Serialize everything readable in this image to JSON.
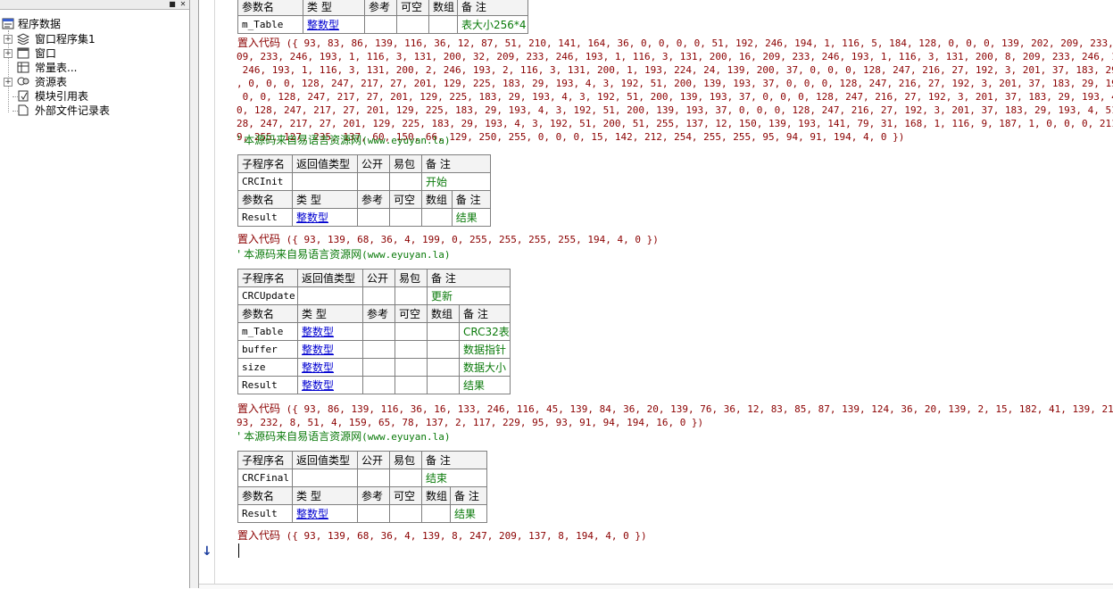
{
  "tree": {
    "root": "程序数据",
    "items": [
      {
        "label": "窗口程序集1"
      },
      {
        "label": "窗口"
      },
      {
        "label": "常量表..."
      },
      {
        "label": "资源表"
      },
      {
        "label": "模块引用表"
      },
      {
        "label": "外部文件记录表"
      }
    ],
    "topbar": {
      "pin": "■",
      "close": "✕"
    }
  },
  "headers": {
    "sub": "子程序名",
    "ret": "返回值类型",
    "pub": "公开",
    "easy": "易包",
    "note": "备 注",
    "param": "参数名",
    "type": "类 型",
    "ref": "参考",
    "nullable": "可空",
    "array": "数组"
  },
  "top_table": {
    "param": "m_Table",
    "type": "整数型",
    "note": "表大小256*4"
  },
  "block1": {
    "kw": "置入代码",
    "lines": [
      " ({ 93, 83, 86, 139, 116, 36, 12, 87, 51, 210, 141, 164, 36, 0, 0, 0, 0, 51, 192, 246, 194, 1, 116, 5, 184, 128, 0, 0, 0, 139, 202, 209, 233, 246, 193, 1, 116,",
      "09, 233, 246, 193, 1, 116, 3, 131, 200, 32, 209, 233, 246, 193, 1, 116, 3, 131, 200, 16, 209, 233, 246, 193, 1, 116, 3, 131, 200, 8, 209, 233, 246, 193, 1, 116, 3,",
      " 246, 193, 1, 116, 3, 131, 200, 2, 246, 193, 2, 116, 3, 131, 200, 1, 193, 224, 24, 139, 200, 37, 0, 0, 0, 128, 247, 216, 27, 192, 3, 201, 37, 183, 29, 193, 4, 51,",
      ", 0, 0, 0, 128, 247, 217, 27, 201, 129, 225, 183, 29, 193, 4, 3, 192, 51, 200, 139, 193, 37, 0, 0, 0, 128, 247, 216, 27, 192, 3, 201, 37, 183, 29, 193, 4, 51, 193,",
      " 0, 0, 128, 247, 217, 27, 201, 129, 225, 183, 29, 193, 4, 3, 192, 51, 200, 139, 193, 37, 0, 0, 0, 128, 247, 216, 27, 192, 3, 201, 37, 183, 29, 193, 4, 51, 193, 139,",
      "0, 128, 247, 217, 27, 201, 129, 225, 183, 29, 193, 4, 3, 192, 51, 200, 139, 193, 37, 0, 0, 0, 128, 247, 216, 27, 192, 3, 201, 37, 183, 29, 193, 4, 51, 193, 139, 200,",
      "28, 247, 217, 27, 201, 129, 225, 183, 29, 193, 4, 3, 192, 51, 200, 51, 255, 137, 12, 150, 139, 193, 141, 79, 31, 168, 1, 116, 9, 187, 1, 0, 0, 0, 211, 227, 11, 251,",
      "9, 255, 127, 235, 137, 60, 150, 66, 129, 250, 255, 0, 0, 0, 15, 142, 212, 254, 255, 255, 95, 94, 91, 194, 4, 0 })"
    ]
  },
  "comment": {
    "text": "' 本源码来自易语言资源网",
    "url": "(www.eyuyan.la)"
  },
  "crc_init": {
    "name": "CRCInit",
    "note": "开始",
    "params": [
      {
        "name": "Result",
        "type": "整数型",
        "note": "结果"
      }
    ],
    "code": " ({ 93, 139, 68, 36, 4, 199, 0, 255, 255, 255, 255, 194, 4, 0 })"
  },
  "crc_update": {
    "name": "CRCUpdate",
    "note": "更新",
    "params": [
      {
        "name": "m_Table",
        "type": "整数型",
        "note": "CRC32表"
      },
      {
        "name": "buffer",
        "type": "整数型",
        "note": "数据指针"
      },
      {
        "name": "size",
        "type": "整数型",
        "note": "数据大小"
      },
      {
        "name": "Result",
        "type": "整数型",
        "note": "结果"
      }
    ],
    "code_lines": [
      " ({ 93, 86, 139, 116, 36, 16, 133, 246, 116, 45, 139, 84, 36, 20, 139, 76, 36, 12, 83, 85, 87, 139, 124, 36, 20, 139, 2, 15, 182, 41, 139, 216, 129, 227, 255,",
      "93, 232, 8, 51, 4, 159, 65, 78, 137, 2, 117, 229, 95, 93, 91, 94, 194, 16, 0 })"
    ]
  },
  "crc_final": {
    "name": "CRCFinal",
    "note": "结束",
    "params": [
      {
        "name": "Result",
        "type": "整数型",
        "note": "结果"
      }
    ],
    "code": " ({ 93, 139, 68, 36, 4, 139, 8, 247, 209, 137, 8, 194, 4, 0 })"
  }
}
